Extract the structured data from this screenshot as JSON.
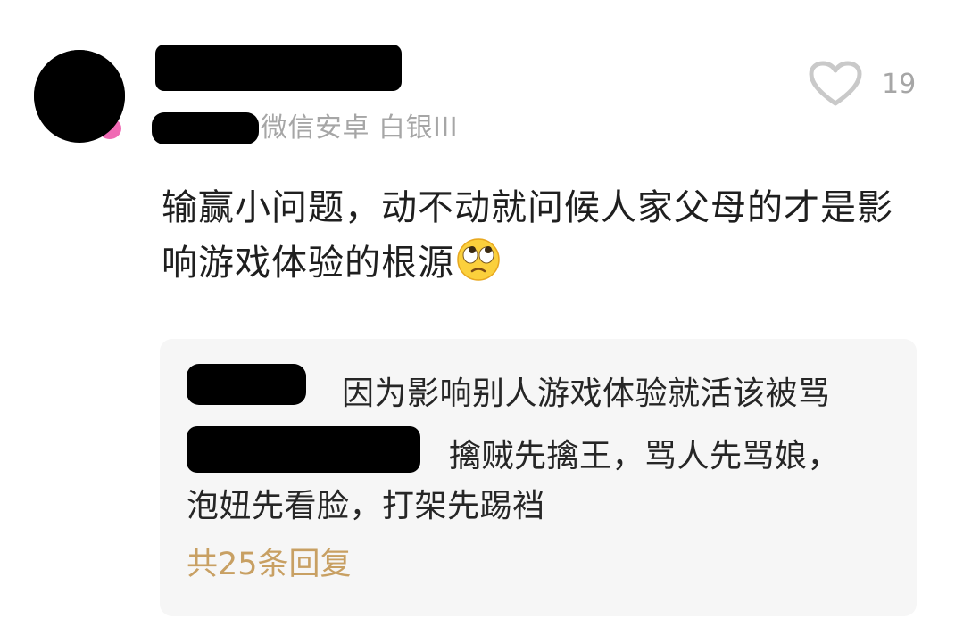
{
  "comment": {
    "meta": "微信安卓 白银III",
    "likes": "19",
    "text": "输赢小问题，动不动就问候人家父母的才是影响游戏体验的根源",
    "emoji": "eye-roll-emoji"
  },
  "replies": {
    "items": [
      {
        "text": "因为影响别人游戏体验就活该被骂"
      },
      {
        "text_line1": "擒贼先擒王，骂人先骂娘，",
        "text_line2": "泡妞先看脸，打架先踢裆"
      }
    ],
    "more_label": "共25条回复"
  },
  "colors": {
    "background": "#ffffff",
    "reply_box": "#f6f6f6",
    "primary_text": "#1f1f1f",
    "secondary_text": "#a6a6a6",
    "more_link": "#c8a063"
  }
}
